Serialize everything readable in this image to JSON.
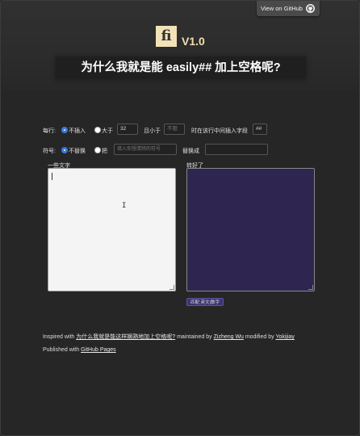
{
  "github_button": {
    "label": "View on GitHub",
    "icon": "github-icon"
  },
  "logo": {
    "glyph": "fi",
    "version": "V1.0"
  },
  "title": "为什么我就是能 easily## 加上空格呢?",
  "options": {
    "per_line_label": "每行:",
    "no_insert_label": "不插入",
    "greater_label": "大于",
    "greater_value": "32",
    "and_less_label": "且小于",
    "less_placeholder": "不限",
    "insert_label": "时在该行中间插入字段",
    "insert_value": "##",
    "symbol_label": "符号:",
    "no_replace_label": "不替换",
    "replace_label": "把",
    "replace_placeholder": "填入你想清除的符号",
    "replace_to_label": "替换成",
    "replace_to_value": ""
  },
  "input_area": {
    "label": "一些文字"
  },
  "output_area": {
    "label": "转好了"
  },
  "match_button": {
    "label": "匹配 英文|数字"
  },
  "footer": {
    "inspired_prefix": "Inspired with ",
    "inspired_link": "为什么我就是能这样娴熟地加上空格呢?",
    "maintained_by": " maintained by ",
    "maintainer": "Zizheng Wu",
    "modified_by": " modified by ",
    "modifier": "Yokijiay",
    "published_prefix": "Published with ",
    "published_link": "GitHub Pages"
  },
  "colors": {
    "accent": "#3d78d8",
    "logo_bg": "#f3e2b8",
    "output_bg": "#2e2550"
  }
}
